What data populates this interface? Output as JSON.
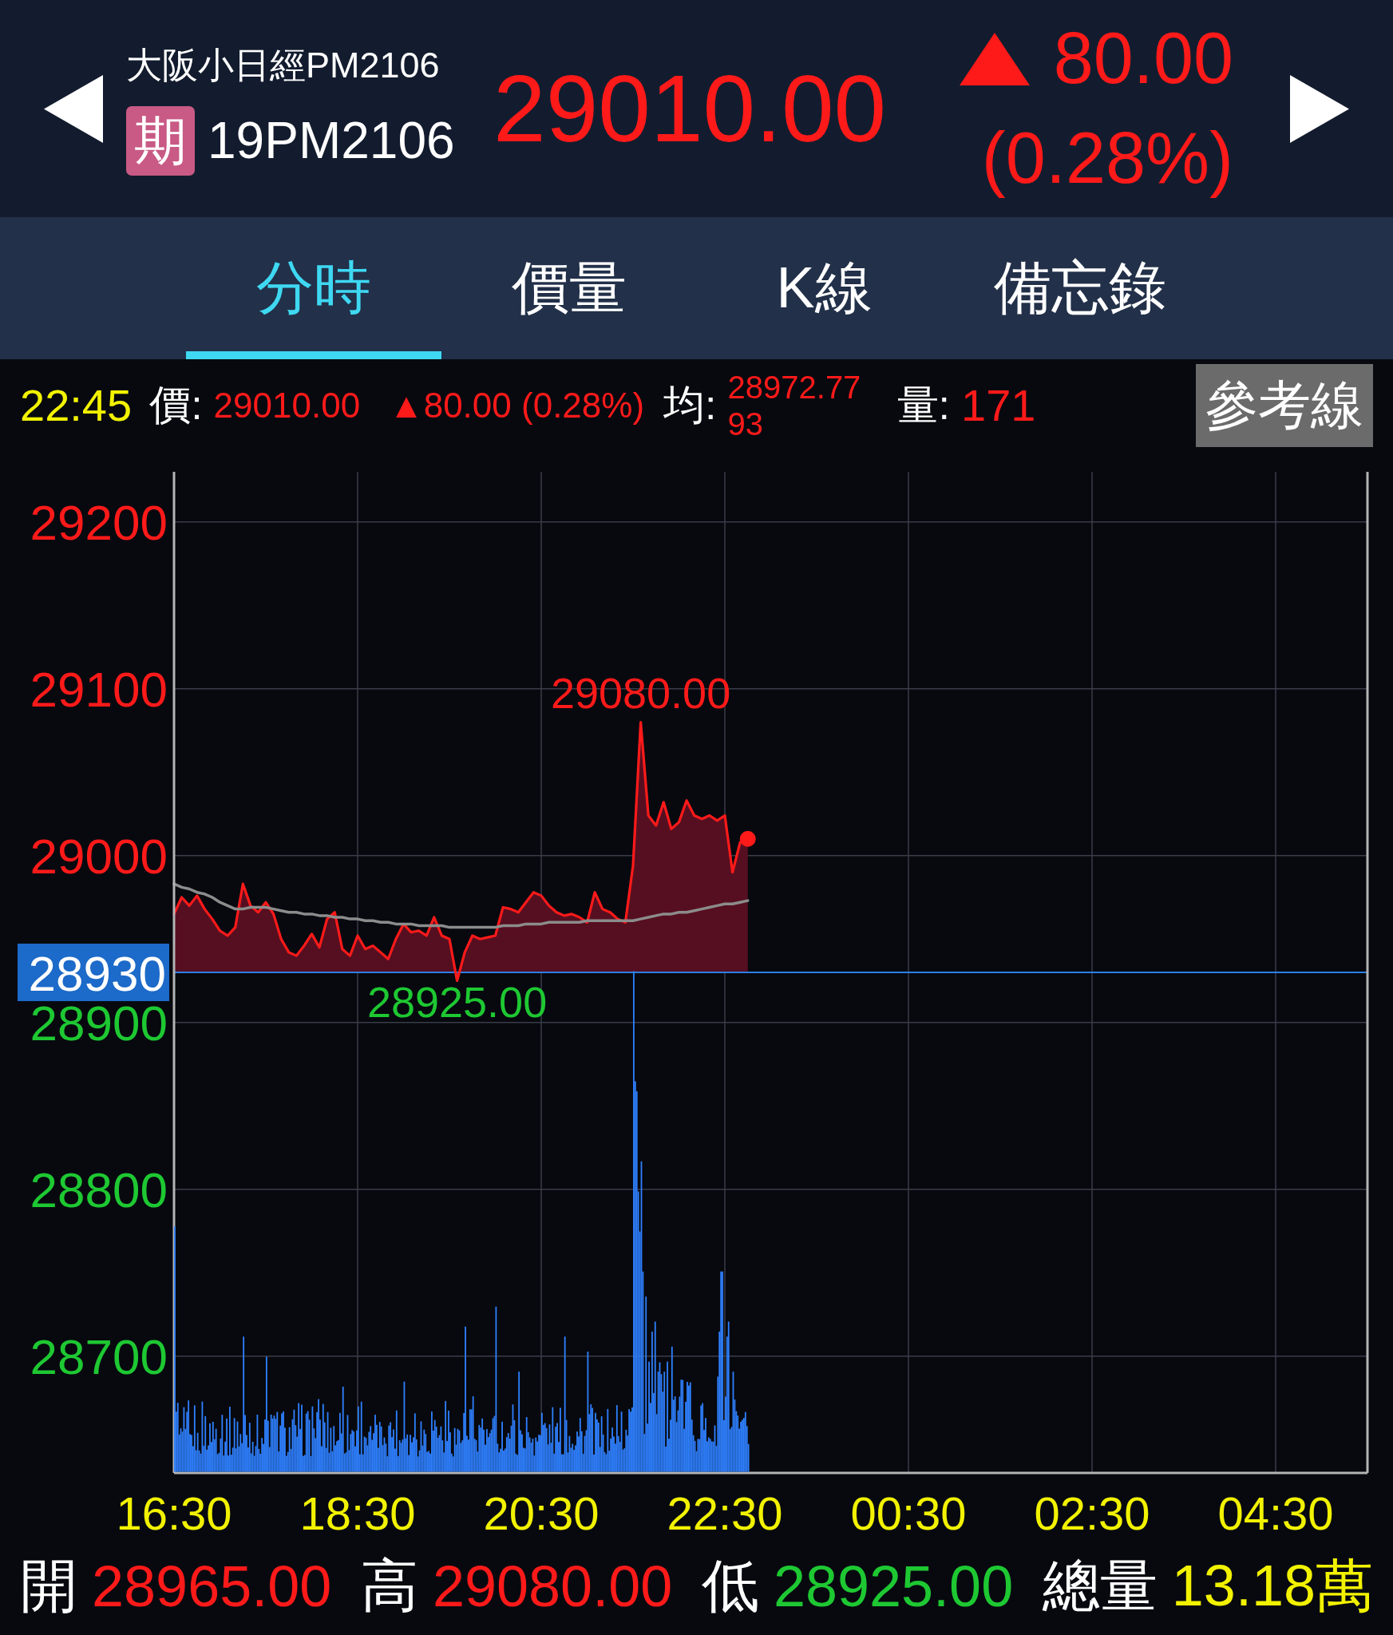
{
  "header": {
    "name": "大阪小日經PM2106",
    "badge": "期",
    "code": "19PM2106",
    "price": "29010.00",
    "change": "80.00",
    "change_percent": "(0.28%)",
    "rising": true
  },
  "tabs": [
    {
      "label": "分時",
      "selected": true
    },
    {
      "label": "價量",
      "selected": false
    },
    {
      "label": "K線",
      "selected": false
    },
    {
      "label": "備忘錄",
      "selected": false
    }
  ],
  "quote_bar": {
    "time": "22:45",
    "price_label": "價:",
    "price": "29010.00",
    "change": "▲80.00 (0.28%)",
    "average_label": "均:",
    "average": "28972.7793",
    "volume_label": "量:",
    "volume": "171",
    "rising": true,
    "button": "參考線"
  },
  "chart": {
    "chart_data": {
      "type": "line",
      "categories": [
        "16:30",
        null,
        null,
        null,
        null,
        null,
        null,
        null,
        null,
        null,
        null,
        null,
        null,
        null,
        null,
        null,
        null,
        null,
        null,
        null,
        null,
        null,
        null,
        null,
        "18:30",
        null,
        null,
        null,
        null,
        null,
        null,
        null,
        null,
        null,
        null,
        null,
        null,
        null,
        null,
        null,
        null,
        null,
        null,
        null,
        null,
        null,
        null,
        null,
        "20:30",
        null,
        null,
        null,
        null,
        null,
        null,
        null,
        null,
        null,
        null,
        null,
        null,
        null,
        null,
        null,
        null,
        null,
        null,
        null,
        null,
        null,
        null,
        null,
        "22:30",
        null,
        null,
        null,
        null,
        null,
        null,
        null,
        null,
        null,
        null,
        null,
        null,
        null,
        null,
        null,
        null,
        null,
        null,
        null,
        null,
        null,
        null,
        null,
        "00:30",
        null,
        null,
        null,
        null,
        null,
        null,
        null,
        null,
        null,
        null,
        null,
        null,
        null,
        null,
        null,
        null,
        null,
        null,
        null,
        null,
        null,
        null,
        null,
        "02:30",
        null,
        null,
        null,
        null,
        null,
        null,
        null,
        null,
        null,
        null,
        null,
        null,
        null,
        null,
        null,
        null,
        null,
        null,
        null,
        null,
        null,
        null,
        null,
        "04:30",
        null,
        null,
        null,
        null,
        null,
        null,
        null,
        null,
        null,
        null,
        null,
        null
      ],
      "series": [
        {
          "color": "#ff1a1a",
          "values": [
            28965,
            28975,
            28970,
            28976,
            28968,
            28962,
            28955,
            28952,
            28957,
            28983,
            28970,
            28966,
            28972,
            28965,
            28950,
            28942,
            28940,
            28946,
            28953,
            28945,
            28962,
            28966,
            28944,
            28940,
            28952,
            28944,
            28946,
            28942,
            28938,
            28950,
            28959,
            28954,
            28955,
            28952,
            28963,
            28952,
            28950,
            28925,
            28942,
            28952,
            28950,
            28951,
            28952,
            28969,
            28968,
            28966,
            28972,
            28978,
            28976,
            28970,
            28966,
            28964,
            28965,
            28963,
            28960,
            28978,
            28968,
            28966,
            28962,
            28960,
            28994,
            29080,
            29024,
            29018,
            29032,
            29016,
            29020,
            29033,
            29024,
            29022,
            29024,
            29021,
            29024,
            28990,
            29008,
            29010,
            null,
            null,
            null,
            null,
            null,
            null,
            null,
            null,
            null,
            null,
            null,
            null,
            null,
            null,
            null,
            null,
            null,
            null,
            null,
            null,
            null,
            null,
            null,
            null,
            null,
            null,
            null,
            null,
            null,
            null,
            null,
            null,
            null,
            null,
            null,
            null,
            null,
            null,
            null,
            null,
            null,
            null,
            null,
            null,
            null,
            null,
            null,
            null,
            null,
            null,
            null,
            null,
            null,
            null,
            null,
            null,
            null,
            null,
            null,
            null,
            null,
            null,
            null,
            null,
            null,
            null,
            null,
            null,
            null,
            null,
            null,
            null,
            null,
            null,
            null,
            null,
            null,
            null,
            null,
            null,
            null
          ]
        },
        {
          "color": "#8c8c8c",
          "values": [
            28983,
            28981,
            28980,
            28978,
            28977,
            28975,
            28972,
            28970,
            28968,
            28968,
            28969,
            28969,
            28969,
            28968,
            28967,
            28966,
            28966,
            28965,
            28965,
            28964,
            28964,
            28963,
            28963,
            28962,
            28962,
            28961,
            28961,
            28960,
            28960,
            28959,
            28959,
            28959,
            28958,
            28958,
            28958,
            28958,
            28957,
            28957,
            28957,
            28957,
            28957,
            28957,
            28957,
            28958,
            28958,
            28958,
            28959,
            28959,
            28959,
            28960,
            28960,
            28960,
            28960,
            28960,
            28961,
            28961,
            28961,
            28961,
            28961,
            28961,
            28961,
            28962,
            28963,
            28964,
            28965,
            28965,
            28966,
            28966,
            28967,
            28968,
            28969,
            28970,
            28971,
            28971,
            28972,
            28973,
            null,
            null,
            null,
            null,
            null,
            null,
            null,
            null,
            null,
            null,
            null,
            null,
            null,
            null,
            null,
            null,
            null,
            null,
            null,
            null,
            null,
            null,
            null,
            null,
            null,
            null,
            null,
            null,
            null,
            null,
            null,
            null,
            null,
            null,
            null,
            null,
            null,
            null,
            null,
            null,
            null,
            null,
            null,
            null,
            null,
            null,
            null,
            null,
            null,
            null,
            null,
            null,
            null,
            null,
            null,
            null,
            null,
            null,
            null,
            null,
            null,
            null,
            null,
            null,
            null,
            null,
            null,
            null,
            null,
            null,
            null,
            null,
            null,
            null,
            null,
            null,
            null,
            null,
            null,
            null,
            null
          ]
        }
      ],
      "ylim": [
        28630,
        29230
      ],
      "yticks": [
        29200,
        29100,
        29000,
        28900,
        28800,
        28700
      ],
      "grid": true,
      "ref_lines": [
        {
          "axis": "y",
          "value": 28930,
          "label": "28930"
        }
      ],
      "annotations": [
        "29080.00",
        "28925.00"
      ]
    }
  },
  "footer": [
    {
      "label": "開",
      "value": "28965.00",
      "color": "#ff1a1a"
    },
    {
      "label": "高",
      "value": "29080.00",
      "color": "#ff1a1a"
    },
    {
      "label": "低",
      "value": "28925.00",
      "color": "#1ec832"
    },
    {
      "label": "總量",
      "value": "13.18萬",
      "color": "#f2f200"
    }
  ]
}
